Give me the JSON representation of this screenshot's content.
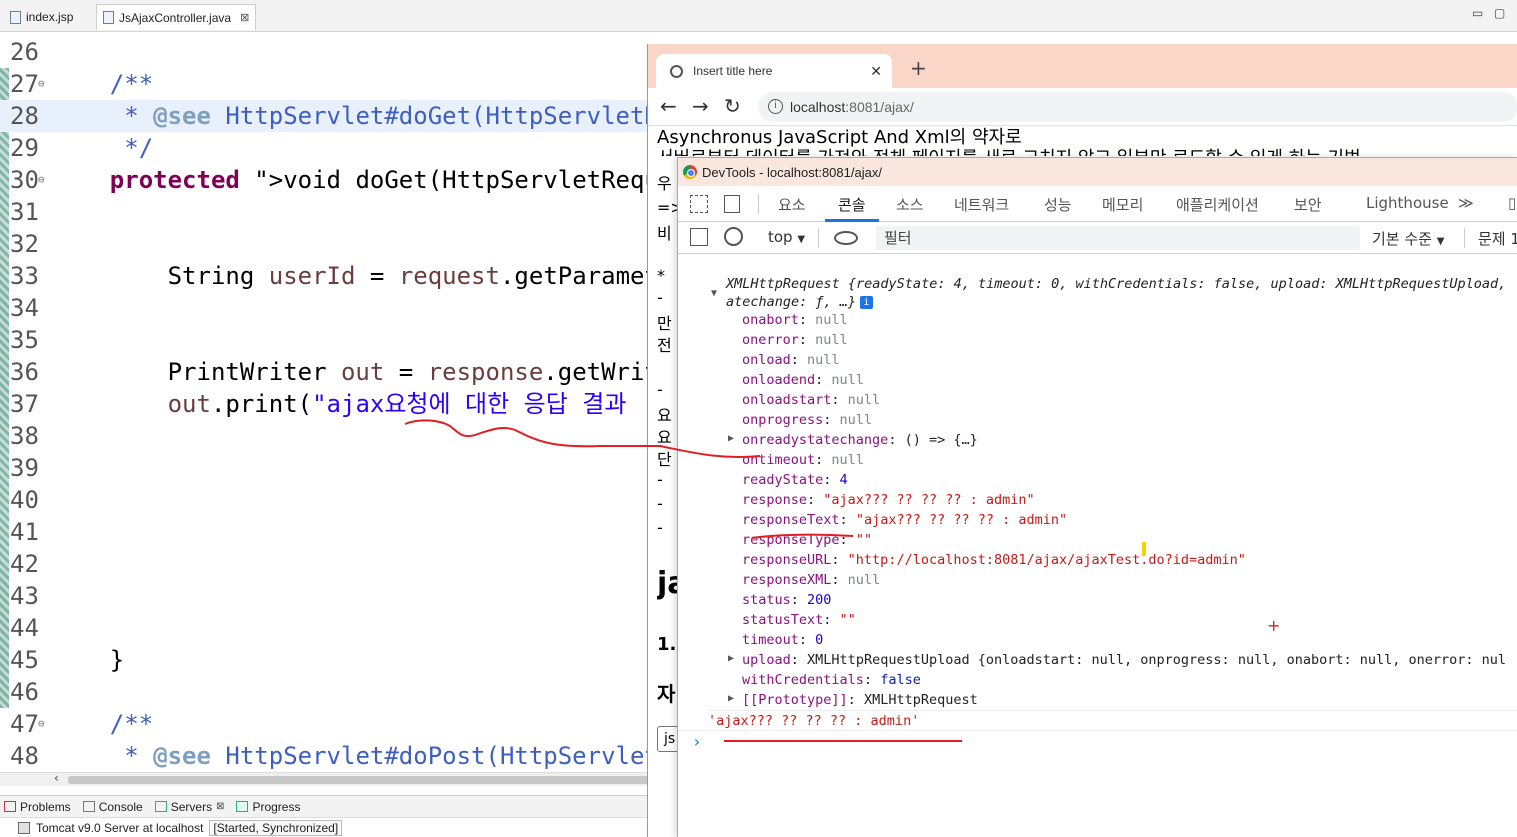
{
  "editor": {
    "tabs": [
      {
        "label": "index.jsp"
      },
      {
        "label": "JsAjaxController.java"
      }
    ],
    "window_controls": {
      "minimize": "▭",
      "maximize": "▢",
      "collapse": "^"
    },
    "lines": [
      {
        "num": "26",
        "text": ""
      },
      {
        "num": "27",
        "text": "    /**"
      },
      {
        "num": "28",
        "text": "     * @see HttpServlet#doGet(HttpServletRequest"
      },
      {
        "num": "29",
        "text": "     */"
      },
      {
        "num": "30",
        "text": "    protected void doGet(HttpServletRequest"
      },
      {
        "num": "31",
        "text": ""
      },
      {
        "num": "32",
        "text": ""
      },
      {
        "num": "33",
        "text": "        String userId = request.getParameter"
      },
      {
        "num": "34",
        "text": ""
      },
      {
        "num": "35",
        "text": ""
      },
      {
        "num": "36",
        "text": "        PrintWriter out = response.getWriter"
      },
      {
        "num": "37",
        "text": "        out.print(\"ajax요청에 대한 응답 결과"
      },
      {
        "num": "38",
        "text": ""
      },
      {
        "num": "39",
        "text": ""
      },
      {
        "num": "40",
        "text": ""
      },
      {
        "num": "41",
        "text": ""
      },
      {
        "num": "42",
        "text": ""
      },
      {
        "num": "43",
        "text": ""
      },
      {
        "num": "44",
        "text": ""
      },
      {
        "num": "45",
        "text": "    }"
      },
      {
        "num": "46",
        "text": ""
      },
      {
        "num": "47",
        "text": "    /**"
      },
      {
        "num": "48",
        "text": "     * @see HttpServlet#doPost(HttpServletRequest"
      }
    ],
    "views": [
      {
        "label": "Problems"
      },
      {
        "label": "Console"
      },
      {
        "label": "Servers"
      },
      {
        "label": "Progress"
      }
    ],
    "server_status": {
      "name": "Tomcat v9.0 Server at localhost",
      "state": "[Started, Synchronized]"
    }
  },
  "browser": {
    "tab_title": "Insert title here",
    "new_tab": "+",
    "url_host": "localhost",
    "url_rest": ":8081/ajax/",
    "page_line1": "Asynchronus JavaScript And Xml의 약자로",
    "page_line2": "서버로부터 데이터를 가져와 전체 페이지를 새로 고치지 않고 일부만 로드할 수 있게 하는 기법",
    "peek_lines": [
      "우",
      "=>",
      "비",
      "* ",
      "- ",
      "만",
      "전",
      "- ",
      "요",
      "요",
      "단",
      "- ",
      "- ",
      "- "
    ],
    "peek_big": [
      "ja",
      "1.",
      "자"
    ],
    "peek_box": "js"
  },
  "devtools": {
    "title": "DevTools - localhost:8081/ajax/",
    "tabs": [
      "요소",
      "콘솔",
      "소스",
      "네트워크",
      "성능",
      "메모리",
      "애플리케이션",
      "보안",
      "Lighthouse"
    ],
    "more": "≫",
    "right_edge": "▯",
    "context": "top",
    "filter_placeholder": "필터",
    "level": "기본 수준",
    "issues": "문제 1",
    "console": {
      "summary": "XMLHttpRequest {readyState: 4, timeout: 0, withCredentials: false, upload: XMLHttpRequestUpload,",
      "summary2": "atechange: ƒ, …}",
      "info_icon": "i",
      "props": [
        {
          "key": "onabort",
          "val": "null",
          "type": "null"
        },
        {
          "key": "onerror",
          "val": "null",
          "type": "null"
        },
        {
          "key": "onload",
          "val": "null",
          "type": "null"
        },
        {
          "key": "onloadend",
          "val": "null",
          "type": "null"
        },
        {
          "key": "onloadstart",
          "val": "null",
          "type": "null"
        },
        {
          "key": "onprogress",
          "val": "null",
          "type": "null"
        },
        {
          "key": "onreadystatechange",
          "val": "() => {…}",
          "type": "obj",
          "expand": true
        },
        {
          "key": "ontimeout",
          "val": "null",
          "type": "null"
        },
        {
          "key": "readyState",
          "val": "4",
          "type": "num"
        },
        {
          "key": "response",
          "val": "\"ajax??? ?? ?? ?? : admin\"",
          "type": "str"
        },
        {
          "key": "responseText",
          "val": "\"ajax??? ?? ?? ?? : admin\"",
          "type": "str"
        },
        {
          "key": "responseType",
          "val": "\"\"",
          "type": "str"
        },
        {
          "key": "responseURL",
          "val": "\"http://localhost:8081/ajax/ajaxTest.do?id=admin\"",
          "type": "str"
        },
        {
          "key": "responseXML",
          "val": "null",
          "type": "null"
        },
        {
          "key": "status",
          "val": "200",
          "type": "num"
        },
        {
          "key": "statusText",
          "val": "\"\"",
          "type": "str"
        },
        {
          "key": "timeout",
          "val": "0",
          "type": "num"
        },
        {
          "key": "upload",
          "val": "XMLHttpRequestUpload {onloadstart: null, onprogress: null, onabort: null, onerror: nul",
          "type": "obj",
          "expand": true
        },
        {
          "key": "withCredentials",
          "val": "false",
          "type": "bool"
        },
        {
          "key": "[[Prototype]]",
          "val": "XMLHttpRequest",
          "type": "obj",
          "expand": true
        }
      ],
      "string_output": "'ajax??? ?? ?? ?? : admin'",
      "prompt": "›"
    }
  },
  "annotation_marks": {
    "cross": "+"
  }
}
